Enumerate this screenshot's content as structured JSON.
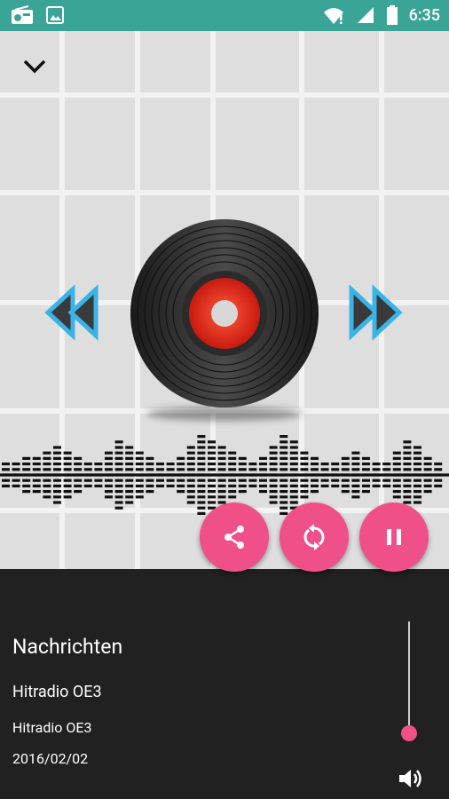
{
  "status_bar": {
    "time": "6:35",
    "icons": [
      "radio-icon",
      "image-icon",
      "wifi-icon",
      "signal-icon",
      "battery-icon"
    ]
  },
  "player": {
    "collapse_icon": "chevron-down-icon",
    "prev_icon": "rewind-icon",
    "next_icon": "fast-forward-icon",
    "disc_icon": "vinyl-record-icon"
  },
  "actions": {
    "share_icon": "share-icon",
    "repeat_icon": "repeat-icon",
    "pause_icon": "pause-icon",
    "accent": "#f0508a"
  },
  "track": {
    "title": "Nachrichten",
    "station": "Hitradio OE3",
    "station_sub": "Hitradio OE3",
    "date": "2016/02/02"
  },
  "volume": {
    "level": 0.08,
    "icon": "volume-icon"
  },
  "colors": {
    "status_bar": "#3aa596",
    "bottom_panel": "#212121",
    "arrow_blue": "#3ab3e6",
    "record_red": "#e02418"
  }
}
